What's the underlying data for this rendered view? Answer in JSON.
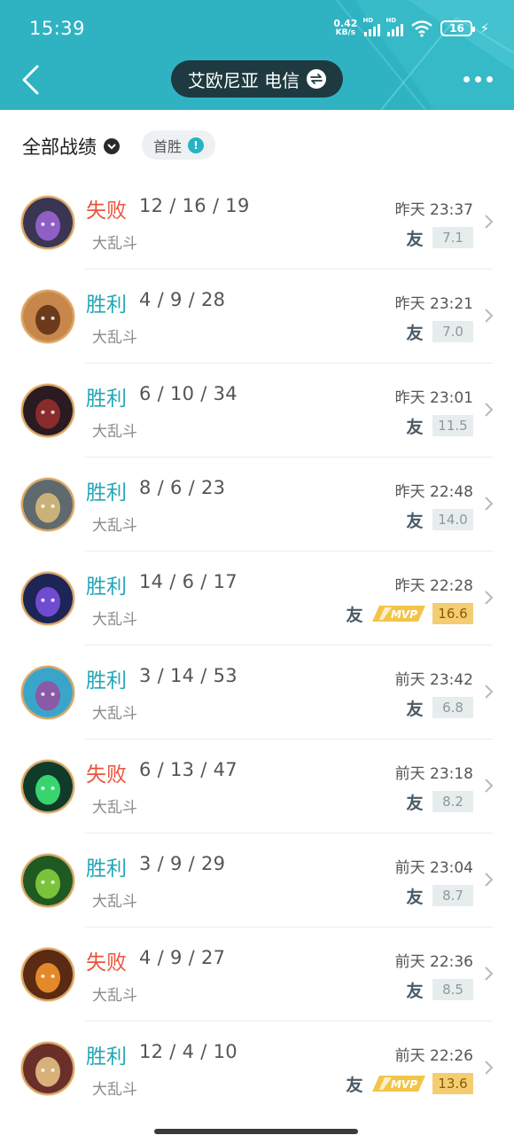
{
  "status_bar": {
    "time": "15:39",
    "net_speed_value": "0.42",
    "net_speed_unit": "KB/s",
    "sim1_label": "HD",
    "sim2_label": "HD",
    "battery": "16"
  },
  "header": {
    "title": "艾欧尼亚 电信",
    "bg_color": "#2fb3c2",
    "pill_color": "#1e3a40"
  },
  "filter": {
    "label": "全部战绩",
    "chip_label": "首胜",
    "chip_info": "!"
  },
  "matches": [
    {
      "result": "失败",
      "outcome": "loss",
      "kda": "12 / 16 / 19",
      "mode": "大乱斗",
      "time": "昨天 23:37",
      "mvp": false,
      "score": "7.1"
    },
    {
      "result": "胜利",
      "outcome": "win",
      "kda": "4 / 9 / 28",
      "mode": "大乱斗",
      "time": "昨天 23:21",
      "mvp": false,
      "score": "7.0"
    },
    {
      "result": "胜利",
      "outcome": "win",
      "kda": "6 / 10 / 34",
      "mode": "大乱斗",
      "time": "昨天 23:01",
      "mvp": false,
      "score": "11.5"
    },
    {
      "result": "胜利",
      "outcome": "win",
      "kda": "8 / 6 / 23",
      "mode": "大乱斗",
      "time": "昨天 22:48",
      "mvp": false,
      "score": "14.0"
    },
    {
      "result": "胜利",
      "outcome": "win",
      "kda": "14 / 6 / 17",
      "mode": "大乱斗",
      "time": "昨天 22:28",
      "mvp": true,
      "score": "16.6"
    },
    {
      "result": "胜利",
      "outcome": "win",
      "kda": "3 / 14 / 53",
      "mode": "大乱斗",
      "time": "前天 23:42",
      "mvp": false,
      "score": "6.8"
    },
    {
      "result": "失败",
      "outcome": "loss",
      "kda": "6 / 13 / 47",
      "mode": "大乱斗",
      "time": "前天 23:18",
      "mvp": false,
      "score": "8.2"
    },
    {
      "result": "胜利",
      "outcome": "win",
      "kda": "3 / 9 / 29",
      "mode": "大乱斗",
      "time": "前天 23:04",
      "mvp": false,
      "score": "8.7"
    },
    {
      "result": "失败",
      "outcome": "loss",
      "kda": "4 / 9 / 27",
      "mode": "大乱斗",
      "time": "前天 22:36",
      "mvp": false,
      "score": "8.5"
    },
    {
      "result": "胜利",
      "outcome": "win",
      "kda": "12 / 4 / 10",
      "mode": "大乱斗",
      "time": "前天 22:26",
      "mvp": true,
      "score": "13.6"
    }
  ],
  "friend_badge_text": "友",
  "mvp_badge_text": "MVP",
  "colors": {
    "win": "#23a6b6",
    "loss": "#e9543c",
    "mvp_gold": "#f4cd73"
  },
  "avatars": [
    {
      "bg": "#3a3552",
      "accent": "#8e5fc4"
    },
    {
      "bg": "#c8874a",
      "accent": "#6b3a1c"
    },
    {
      "bg": "#2a1a22",
      "accent": "#8a2b2b"
    },
    {
      "bg": "#5f6a6e",
      "accent": "#c9b27a"
    },
    {
      "bg": "#1d2556",
      "accent": "#6f4bd1"
    },
    {
      "bg": "#3aa5c9",
      "accent": "#8a5aa6"
    },
    {
      "bg": "#0f3b2a",
      "accent": "#38d46e"
    },
    {
      "bg": "#1f5a22",
      "accent": "#7ac23a"
    },
    {
      "bg": "#5a2a12",
      "accent": "#e3892a"
    },
    {
      "bg": "#6b2f2a",
      "accent": "#d8b07a"
    }
  ]
}
